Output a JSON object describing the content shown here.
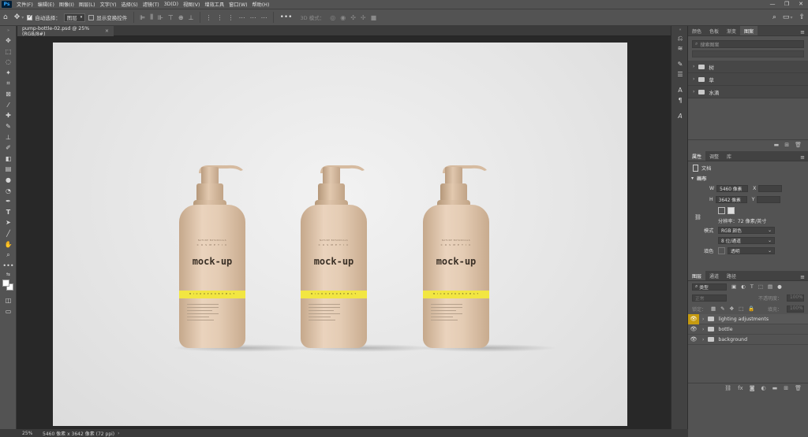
{
  "app": {
    "logo": "Ps"
  },
  "menu": [
    "文件(F)",
    "编辑(E)",
    "图像(I)",
    "图层(L)",
    "文字(Y)",
    "选择(S)",
    "滤镜(T)",
    "3D(D)",
    "视图(V)",
    "增效工具",
    "窗口(W)",
    "帮助(H)"
  ],
  "window_controls": {
    "minimize": "—",
    "restore": "❐",
    "close": "✕"
  },
  "options": {
    "auto_select_label": "自动选择：",
    "auto_select_value": "图层",
    "show_transform_label": "显示变换控件",
    "mode_3d_label": "3D 模式："
  },
  "document": {
    "tab_title": "pump-bottle-02.psd @ 25%(RGB/8#)",
    "tab_close": "×"
  },
  "mockup": {
    "brand": "mock-up",
    "small_line1": "NATURE  BOTANICALS",
    "small_line2": "C O S M E T I C",
    "band_text": "M I C R O P R O B E   M A T"
  },
  "libraries_panel": {
    "tabs": [
      "颜色",
      "色板",
      "渐变",
      "图案"
    ],
    "active_tab": "图案",
    "search_placeholder": "搜索图案",
    "groups": [
      "树",
      "草",
      "水滴"
    ]
  },
  "properties_panel": {
    "tabs": [
      "属性",
      "调整",
      "库"
    ],
    "doc_label": "文档",
    "section_title": "画布",
    "w_label": "W",
    "w_value": "5460 像素",
    "x_label": "X",
    "h_label": "H",
    "h_value": "3642 像素",
    "y_label": "Y",
    "resolution": "分辨率：72 像素/英寸",
    "mode_label": "模式",
    "mode_value": "RGB 颜色",
    "depth_value": "8 位/通道",
    "fill_label": "填色",
    "fill_value": "透明"
  },
  "layers_panel": {
    "tabs": [
      "图层",
      "通道",
      "路径"
    ],
    "filter_label": "类型",
    "blend_mode": "正常",
    "opacity_label": "不透明度：",
    "opacity_value": "100%",
    "lock_label": "锁定：",
    "fill_label": "填充：",
    "fill_value": "100%",
    "layers": [
      {
        "name": "lighting adjustments",
        "selected": true
      },
      {
        "name": "bottle",
        "selected": false
      },
      {
        "name": "background",
        "selected": false
      }
    ]
  },
  "status": {
    "zoom": "25%",
    "doc_info": "5460 像素 x 3642 像素 (72 ppi)",
    "arrow": "›"
  },
  "colors": {
    "accent_layer_eye": "#c69b10",
    "band_yellow": "#f2e642"
  }
}
